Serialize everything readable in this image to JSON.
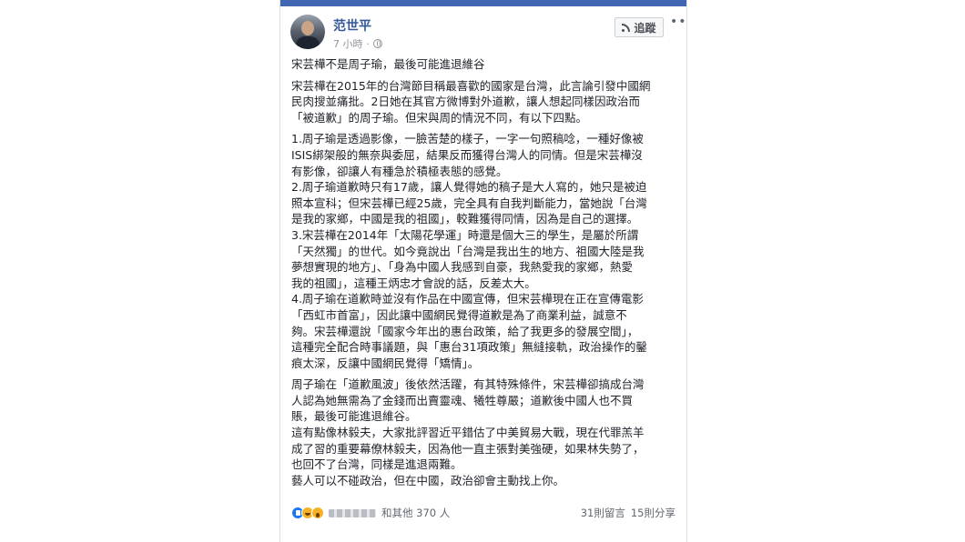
{
  "post": {
    "author": "范世平",
    "time": "7 小時",
    "follow_label": "追蹤",
    "more_label": "•••",
    "paragraphs": [
      [
        "宋芸樺不是周子瑜，最後可能進退維谷"
      ],
      [
        "宋芸樺在2015年的台灣節目稱最喜歡的國家是台灣，此言論引發中國網",
        "民肉搜並痛批。2日她在其官方微博對外道歉，讓人想起同樣因政治而",
        "「被道歉」的周子瑜。但宋與周的情況不同，有以下四點。"
      ],
      [
        "1.周子瑜是透過影像，一臉苦楚的樣子，一字一句照稿唸，一種好像被",
        "ISIS綁架般的無奈與委屈，結果反而獲得台灣人的同情。但是宋芸樺沒",
        "有影像，卻讓人有種急於積極表態的感覺。",
        "2.周子瑜道歉時只有17歲，讓人覺得她的稿子是大人寫的，她只是被迫",
        "照本宣科；但宋芸樺已經25歲，完全具有自我判斷能力，當她說「台灣",
        "是我的家鄉，中國是我的祖國」，較難獲得同情，因為是自己的選擇。",
        "3.宋芸樺在2014年「太陽花學運」時還是個大三的學生，是屬於所謂",
        "「天然獨」的世代。如今竟說出「台灣是我出生的地方、祖國大陸是我",
        "夢想實現的地方」、「身為中國人我感到自豪，我熱愛我的家鄉，熱愛",
        "我的祖國」，這種王炳忠才會說的話，反差太大。",
        "4.周子瑜在道歉時並沒有作品在中國宣傳，但宋芸樺現在正在宣傳電影",
        "「西虹市首富」，因此讓中國網民覺得道歉是為了商業利益，誠意不",
        "夠。宋芸樺還說「國家今年出的惠台政策，給了我更多的發展空間」，",
        "這種完全配合時事議題，與「惠台31項政策」無縫接軌，政治操作的鑿",
        "痕太深，反讓中國網民覺得「矯情」。"
      ],
      [
        "周子瑜在「道歉風波」後依然活躍，有其特殊條件，宋芸樺卻搞成台灣",
        "人認為她無需為了金錢而出賣靈魂、犧牲尊嚴；道歉後中國人也不買",
        "賬，最後可能進退維谷。",
        "這有點像林毅夫，大家批評習近平錯估了中美貿易大戰，現在代罪羔羊",
        "成了習的重要幕僚林毅夫，因為他一直主張對美強硬，如果林失勢了，",
        "也回不了台灣，同樣是進退兩難。",
        "藝人可以不碰政治，但在中國，政治卻會主動找上你。"
      ]
    ],
    "reactions": [
      "like",
      "haha",
      "wow"
    ],
    "others_label": "和其他 370 人",
    "comments": "31則留言",
    "shares": "15則分享"
  },
  "colors": {
    "fb_blue": "#4267b2",
    "link": "#365899",
    "text": "#1d2129",
    "meta": "#90949c"
  }
}
